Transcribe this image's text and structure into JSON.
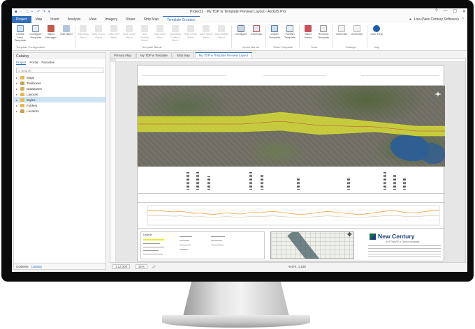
{
  "window": {
    "title": "Project1 - My TDP w Template Preview Layout - ArcGIS Pro",
    "controls": [
      "?",
      "—",
      "☐",
      "✕"
    ]
  },
  "ribbon_tabs": [
    {
      "label": "Project",
      "kind": "project"
    },
    {
      "label": "Map"
    },
    {
      "label": "Insert"
    },
    {
      "label": "Analysis"
    },
    {
      "label": "View"
    },
    {
      "label": "Imagery"
    },
    {
      "label": "Share"
    },
    {
      "label": "Strip Map"
    },
    {
      "label": "Template Creation",
      "kind": "active"
    }
  ],
  "user": {
    "name": "Lisa (New Century Software)"
  },
  "ribbon": {
    "buttons": [
      "Create New Template",
      "Configure Template",
      "Band Manager",
      "Edit Band",
      "Add Map Band",
      "Add Chart Band",
      "Add Text Band",
      "Add Chart Band",
      "Add Station Band",
      "Add Grid Band",
      "Add Map Feature Band",
      "Add Chart Band",
      "Add Table Band",
      "Add Image Band",
      "Configure",
      "Generate",
      "Import Template",
      "Publish Template",
      "Band Areas",
      "Remove Template",
      "Generate",
      "Generate",
      "View Help"
    ],
    "groups": [
      "Template Configuration",
      "Template Bands",
      "Series Bands",
      "Share Template",
      "Tools",
      "Settings",
      "Help"
    ]
  },
  "catalog": {
    "title": "Catalog",
    "tabs": [
      "Project",
      "Portal",
      "Favorites"
    ],
    "search_placeholder": "Search",
    "items": [
      {
        "label": "Maps"
      },
      {
        "label": "Toolboxes"
      },
      {
        "label": "Databases"
      },
      {
        "label": "Layouts"
      },
      {
        "label": "Styles",
        "selected": true
      },
      {
        "label": "Folders"
      },
      {
        "label": "Locators"
      }
    ],
    "footer_tabs": [
      "Contents",
      "Catalog"
    ]
  },
  "view_tabs": [
    {
      "label": "Primary Map"
    },
    {
      "label": "My TDP w Template"
    },
    {
      "label": "Strip Map"
    },
    {
      "label": "My TDP w Template Preview Layout",
      "active": true
    }
  ],
  "layout": {
    "footer": {
      "legend_title": "Legend",
      "company": "New Century",
      "company_sub": "SOFTWARE  a  Clarion company"
    }
  },
  "status_bar": {
    "scale": "1:12,309",
    "zoom": "42%",
    "coords": "-9,474,  1,150"
  },
  "colors": {
    "ribbon_accent": "#2f6fb7",
    "corridor": "#e6ee2e",
    "chart_line": "#f0a040",
    "brand_green": "#0f6e4a",
    "brand_blue": "#1d3f7a"
  },
  "chart_data": {
    "type": "line",
    "title": "",
    "xlabel": "",
    "ylabel": "",
    "series": [
      {
        "values": [
          78,
          72,
          74,
          70,
          68,
          71,
          66,
          60,
          62,
          58,
          55,
          60,
          63,
          59,
          57,
          62,
          66,
          64,
          68,
          70,
          66,
          62,
          58,
          55,
          57,
          61,
          66,
          70,
          68,
          64,
          60,
          57,
          54,
          58,
          63,
          67,
          72,
          75,
          70,
          65,
          62,
          66,
          70,
          74,
          78
        ]
      },
      {
        "values": [
          50,
          48,
          49,
          47,
          46,
          47,
          45,
          43,
          44,
          42,
          41,
          42,
          44,
          42,
          41,
          43,
          45,
          44,
          46,
          47,
          45,
          43,
          41,
          40,
          41,
          43,
          45,
          47,
          46,
          44,
          42,
          41,
          40,
          42,
          44,
          46,
          48,
          49,
          47,
          45,
          44,
          45,
          47,
          49,
          50
        ]
      }
    ],
    "ylim": [
      0,
      100
    ]
  }
}
